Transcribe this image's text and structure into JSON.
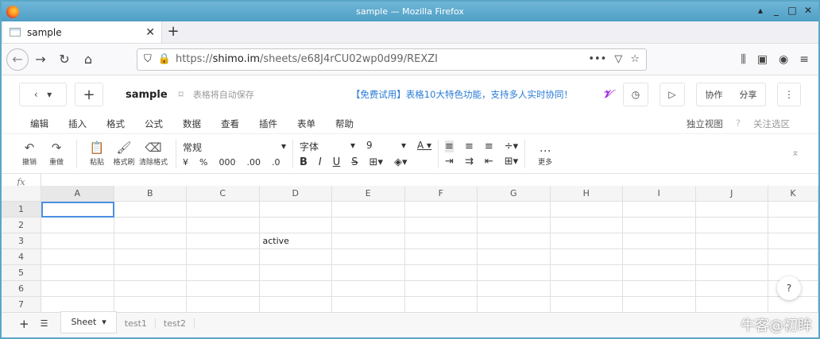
{
  "window": {
    "title": "sample — Mozilla Firefox"
  },
  "tab": {
    "label": "sample"
  },
  "url": {
    "prefix": "https://",
    "host": "shimo.im",
    "path": "/sheets/e68J4rCU02wp0d99/REXZI"
  },
  "app": {
    "doc_name": "sample",
    "autosave": "表格将自动保存",
    "promo": "【免费试用】表格10大特色功能，支持多人实时协同！",
    "collab": "协作",
    "share": "分享"
  },
  "menu": {
    "items": [
      "编辑",
      "插入",
      "格式",
      "公式",
      "数据",
      "查看",
      "插件",
      "表单",
      "帮助"
    ],
    "view": "独立视图",
    "follow": "关注选区"
  },
  "toolbar": {
    "undo": "撤销",
    "redo": "重做",
    "paste": "粘贴",
    "format_painter": "格式刷",
    "clear_format": "清除格式",
    "number_format": "常规",
    "font": "字体",
    "size": "9",
    "more": "更多",
    "currency": "¥",
    "percent": "%",
    "thousands": "000",
    "dec_inc": ".00",
    "dec_dec": ".0"
  },
  "formula": {
    "fx": "fx"
  },
  "grid": {
    "columns": [
      "A",
      "B",
      "C",
      "D",
      "E",
      "F",
      "G",
      "H",
      "I",
      "J",
      "K"
    ],
    "rows": [
      "1",
      "2",
      "3",
      "4",
      "5",
      "6",
      "7"
    ],
    "cells": {
      "3": {
        "D": "active"
      }
    }
  },
  "sheets": {
    "tabs": [
      "Sheet",
      "test1",
      "test2"
    ]
  },
  "watermark": "牛客@初眸",
  "help": "?"
}
